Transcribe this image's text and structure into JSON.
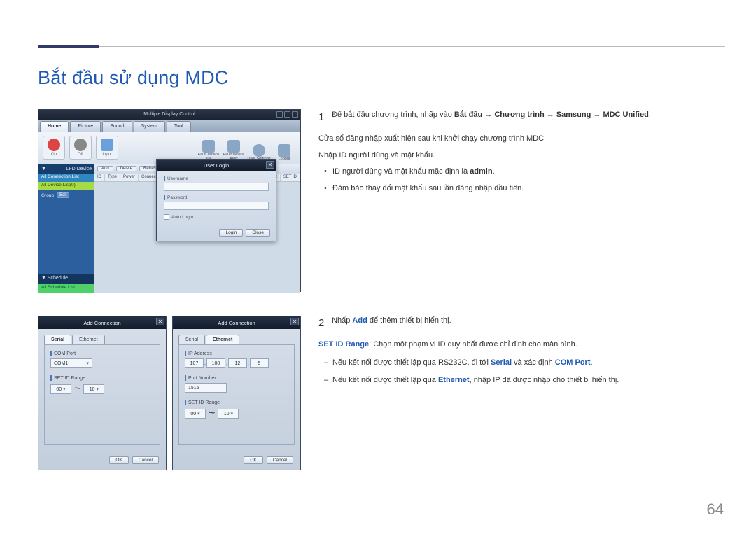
{
  "page": {
    "title": "Bắt đầu sử dụng MDC",
    "number": "64"
  },
  "step1": {
    "num": "1",
    "lead_pre": "Để bắt đầu chương trình, nhấp vào ",
    "path": "Bắt đầu → Chương trình → Samsung → MDC Unified",
    "lead_post": ".",
    "line2": "Cửa sổ đăng nhập xuất hiện sau khi khởi chạy chương trình MDC.",
    "line3": "Nhập ID người dùng và mật khẩu.",
    "bullet1_pre": "ID người dùng và mật khẩu mặc định là ",
    "bullet1_bold": "admin",
    "bullet1_post": ".",
    "bullet2": "Đảm bảo thay đổi mật khẩu sau lần đăng nhập đầu tiên."
  },
  "step2": {
    "num": "2",
    "lead_pre": "Nhấp ",
    "lead_link": "Add",
    "lead_post": " để thêm thiết bị hiển thị.",
    "range_label": "SET ID Range",
    "range_text": ": Chọn một phạm vi ID duy nhất được chỉ định cho màn hình.",
    "dash1_pre": "Nếu kết nối được thiết lập qua RS232C, đi tới ",
    "dash1_serial": "Serial",
    "dash1_mid": " và xác định ",
    "dash1_com": "COM Port",
    "dash1_post": ".",
    "dash2_pre": "Nếu kết nối được thiết lập qua ",
    "dash2_eth": "Ethernet",
    "dash2_post": ", nhập IP đã được nhập cho thiết bị hiển thị."
  },
  "mdc": {
    "title": "Multiple Display Control",
    "tabs": {
      "home": "Home",
      "picture": "Picture",
      "sound": "Sound",
      "system": "System",
      "tool": "Tool"
    },
    "toolbar": {
      "on": "On",
      "off": "Off",
      "input": "Input",
      "fault": "Fault Device (0)",
      "alert": "Fault Device Alert",
      "user": "User Settings",
      "logout": "Logout"
    },
    "side": {
      "lfd": "LFD Device",
      "allconn": "All Connection List",
      "alldev": "All Device List(0)",
      "group": "Group",
      "edit": "Edit",
      "schedule": "Schedule",
      "allsched": "All Schedule List"
    },
    "mainbtns": {
      "add": "Add",
      "del": "Delete",
      "ref": "Refresh"
    },
    "cols": {
      "id": "ID",
      "type": "Type",
      "power": "Power",
      "conn": "Connection Type",
      "port": "Port",
      "setid": "SET ID"
    }
  },
  "login": {
    "title": "User Login",
    "username": "Username",
    "password": "Password",
    "auto": "Auto Login",
    "login_btn": "Login",
    "close_btn": "Close"
  },
  "addcon": {
    "title": "Add Connection",
    "tab_serial": "Serial",
    "tab_eth": "Ethernet",
    "comport_label": "COM Port",
    "comport_value": "COM1",
    "setid_label": "SET ID Range",
    "setid_from": "00",
    "setid_tilde": "~",
    "setid_to": "10",
    "ip_label": "IP Address",
    "ip": {
      "a": "107",
      "b": "108",
      "c": "12",
      "d": "5"
    },
    "port_label": "Port Number",
    "port_value": "1515",
    "ok": "OK",
    "cancel": "Cancel"
  }
}
